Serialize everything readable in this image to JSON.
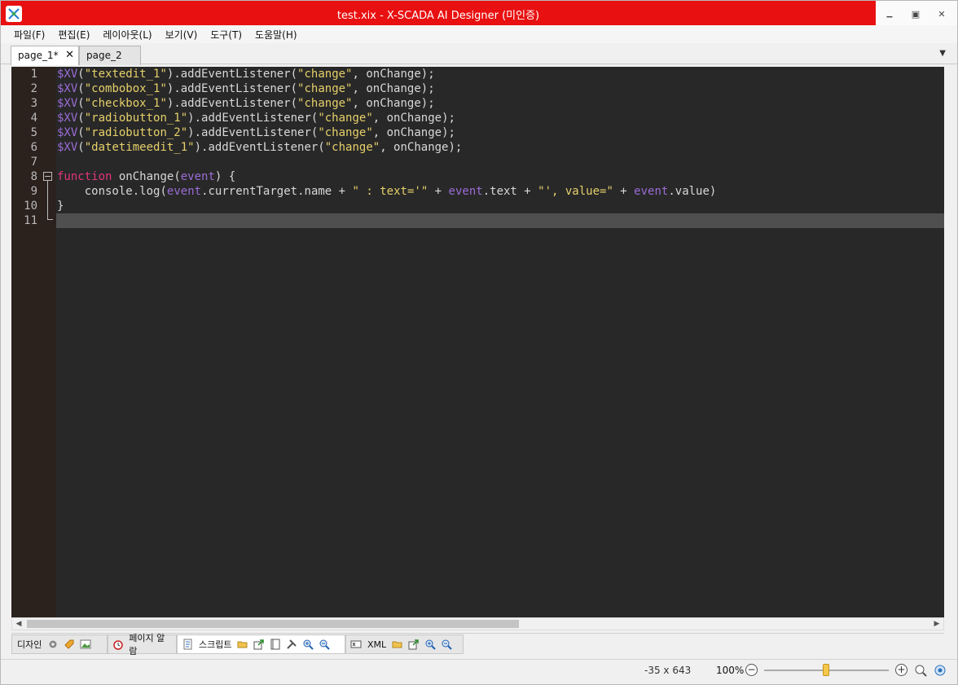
{
  "window": {
    "title": "test.xix - X-SCADA AI Designer (미인증)",
    "logo_text": "X",
    "minimize_glyph": "▁",
    "maximize_glyph": "▣",
    "close_glyph": "✕"
  },
  "menu": {
    "items": [
      "파일(F)",
      "편집(E)",
      "레이아웃(L)",
      "보기(V)",
      "도구(T)",
      "도움말(H)"
    ]
  },
  "tabs": {
    "items": [
      {
        "label": "page_1*",
        "close_glyph": "✕",
        "active": true
      },
      {
        "label": "page_2",
        "active": false
      }
    ],
    "dropdown_glyph": "▼"
  },
  "editor": {
    "line_numbers": [
      "1",
      "2",
      "3",
      "4",
      "5",
      "6",
      "7",
      "8",
      "9",
      "10",
      "11"
    ],
    "fold_glyph": "−",
    "lines": [
      "$XV(\"textedit_1\").addEventListener(\"change\", onChange);",
      "$XV(\"combobox_1\").addEventListener(\"change\", onChange);",
      "$XV(\"checkbox_1\").addEventListener(\"change\", onChange);",
      "$XV(\"radiobutton_1\").addEventListener(\"change\", onChange);",
      "$XV(\"radiobutton_2\").addEventListener(\"change\", onChange);",
      "$XV(\"datetimeedit_1\").addEventListener(\"change\", onChange);",
      "",
      "function onChange(event) {",
      "    console.log(event.currentTarget.name + \" : text='\" + event.text + \"', value=\" + event.value)",
      "}",
      ""
    ],
    "current_line": 11,
    "colors": {
      "background": "#282828",
      "gutter": "#2b211d",
      "keyword": "#e0357a",
      "symbol": "#9b6cd6",
      "string": "#e6d06a",
      "text": "#d8d8d8",
      "current_line": "#4f4f4f"
    }
  },
  "scrollbar": {
    "left_glyph": "◀",
    "right_glyph": "▶"
  },
  "bottom_tabs": {
    "design": {
      "label": "디자인",
      "icons": [
        "gear-icon",
        "tag-icon",
        "image-icon"
      ]
    },
    "page_alarm": {
      "label": "페이지 알람",
      "icons": [
        "alarm-clock-icon"
      ]
    },
    "script": {
      "label": "스크립트",
      "icons": [
        "script-icon",
        "open-folder-icon",
        "export-icon",
        "file-icon",
        "tools-icon",
        "zoom-in-icon",
        "zoom-out-icon"
      ],
      "active": true
    },
    "xml": {
      "label": "XML",
      "icons": [
        "xml-icon",
        "open-folder-icon",
        "export-icon",
        "zoom-in-icon",
        "zoom-out-icon"
      ]
    }
  },
  "status": {
    "coords": "-35 x 643",
    "zoom": "100%",
    "zoom_minus_glyph": "−",
    "zoom_plus_glyph": "+",
    "zoom_level_fraction": 0.5,
    "icons": [
      "zoom-100-icon",
      "fit-window-icon"
    ]
  }
}
